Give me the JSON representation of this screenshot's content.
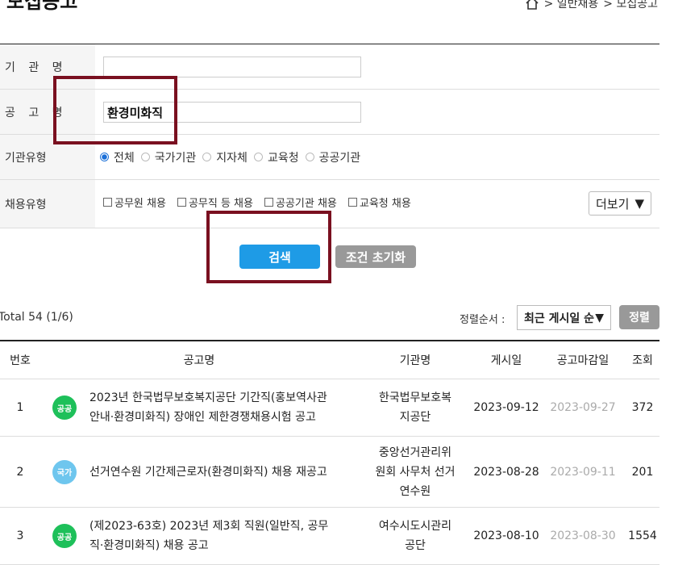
{
  "page": {
    "title": "모집공고"
  },
  "breadcrumb": {
    "items": [
      "> 일반채용",
      "> 모집공고"
    ]
  },
  "form": {
    "org_name_label": "기 관 명",
    "org_name_value": "",
    "notice_name_label": "공 고 명",
    "notice_name_value": "환경미화직",
    "org_type_label": "기관유형",
    "org_type_options": [
      "전체",
      "국가기관",
      "지자체",
      "교육청",
      "공공기관"
    ],
    "org_type_selected": "전체",
    "hire_type_label": "채용유형",
    "hire_type_options": [
      "공무원 채용",
      "공무직 등 채용",
      "공공기관 채용",
      "교육청 채용"
    ],
    "more_label": "더보기",
    "search_label": "검색",
    "reset_label": "조건 초기화"
  },
  "results": {
    "total": "Total 54 (1/6)",
    "sort_label": "정렬순서 :",
    "sort_value": "최근 게시일 순",
    "sort_button": "정렬",
    "columns": [
      "번호",
      "공고명",
      "기관명",
      "게시일",
      "공고마감일",
      "조회"
    ],
    "rows": [
      {
        "num": "1",
        "badge": "공공",
        "badge_color": "#1ec05a",
        "title_l1": "2023년 한국법무보호복지공단 기간직(홍보역사관",
        "title_l2": "안내·환경미화직) 장애인 제한경쟁채용시험 공고",
        "org_l1": "한국법무보호복",
        "org_l2": "지공단",
        "org_l3": "",
        "posted": "2023-09-12",
        "deadline": "2023-09-27",
        "views": "372"
      },
      {
        "num": "2",
        "badge": "국가",
        "badge_color": "#6ec6ee",
        "title_l1": "선거연수원 기간제근로자(환경미화직) 채용 재공고",
        "title_l2": "",
        "org_l1": "중앙선거관리위",
        "org_l2": "원회 사무처 선거",
        "org_l3": "연수원",
        "posted": "2023-08-28",
        "deadline": "2023-09-11",
        "views": "201"
      },
      {
        "num": "3",
        "badge": "공공",
        "badge_color": "#1ec05a",
        "title_l1": "(제2023-63호) 2023년 제3회 직원(일반직, 공무",
        "title_l2": "직·환경미화직) 채용 공고",
        "org_l1": "여수시도시관리",
        "org_l2": "공단",
        "org_l3": "",
        "posted": "2023-08-10",
        "deadline": "2023-08-30",
        "views": "1554"
      }
    ]
  },
  "colors": {
    "primary": "#1e9be6",
    "highlight": "#7a1020",
    "badge_public": "#1ec05a",
    "badge_national": "#6ec6ee"
  }
}
